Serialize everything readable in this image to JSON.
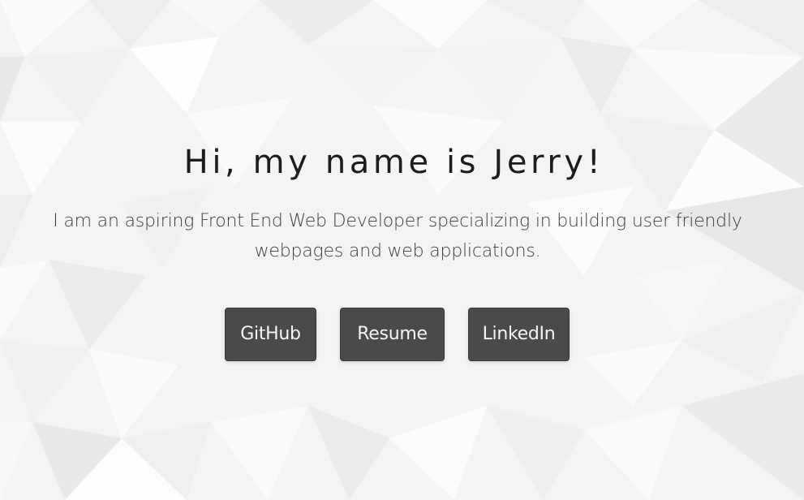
{
  "hero": {
    "title": "Hi, my name is Jerry!",
    "subtitle": "I am an aspiring Front End Web Developer specializing in building user friendly webpages and web applications."
  },
  "links": {
    "github_label": "GitHub",
    "resume_label": "Resume",
    "linkedin_label": "LinkedIn"
  },
  "theme": {
    "background": "#f4f4f4",
    "button_bg": "#4a4a4a",
    "button_text": "#f5f5f5",
    "title_color": "#1c1c1c",
    "subtitle_color": "#3e3e3e"
  }
}
